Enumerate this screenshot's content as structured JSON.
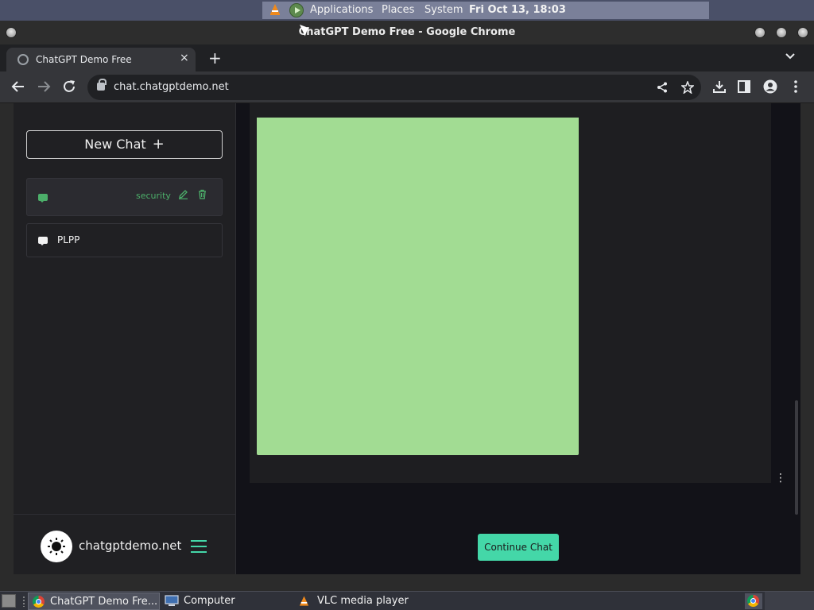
{
  "top_panel": {
    "applications": "Applications",
    "places": "Places",
    "system": "System",
    "datetime": "Fri Oct 13, 18:03"
  },
  "window": {
    "title": "ChatGPT Demo Free - Google Chrome"
  },
  "browser": {
    "tab_title": "ChatGPT Demo Free",
    "tab_close": "×",
    "new_tab": "+",
    "tab_menu": "⌄",
    "url": "chat.chatgptdemo.net"
  },
  "sidebar": {
    "new_chat_label": "New Chat",
    "new_chat_icon": "+",
    "chats": [
      {
        "label": "",
        "tag": "security"
      },
      {
        "label": "PLPP"
      }
    ],
    "footer": {
      "site_name": "chatgptdemo.net"
    }
  },
  "main": {
    "continue_button": "Continue Chat",
    "more_icon": "⋮"
  },
  "taskbar": {
    "tasks": [
      {
        "label": "ChatGPT Demo Fre..."
      },
      {
        "label": "Computer"
      },
      {
        "label": "VLC media player"
      }
    ]
  },
  "colors": {
    "accent": "#44d7a8",
    "active_chat": "#4caf6a",
    "image_fill": "#a2dc93"
  }
}
